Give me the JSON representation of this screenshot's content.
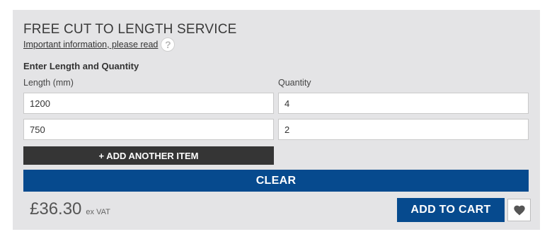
{
  "panel": {
    "title": "FREE CUT TO LENGTH SERVICE",
    "info_link": "Important information, please read",
    "help_icon": "question-mark-icon",
    "section_label": "Enter Length and Quantity",
    "length_label": "Length (mm)",
    "quantity_label": "Quantity"
  },
  "items": [
    {
      "length": "1200",
      "quantity": "4"
    },
    {
      "length": "750",
      "quantity": "2"
    }
  ],
  "buttons": {
    "add_item": "+ ADD ANOTHER ITEM",
    "clear": "CLEAR",
    "add_to_cart": "ADD TO CART",
    "wishlist_icon": "heart-icon"
  },
  "price": {
    "amount": "£36.30",
    "vat_note": "ex VAT"
  },
  "colors": {
    "panel_bg": "#e4e4e6",
    "primary_blue": "#064a8e",
    "dark_button": "#353535"
  }
}
